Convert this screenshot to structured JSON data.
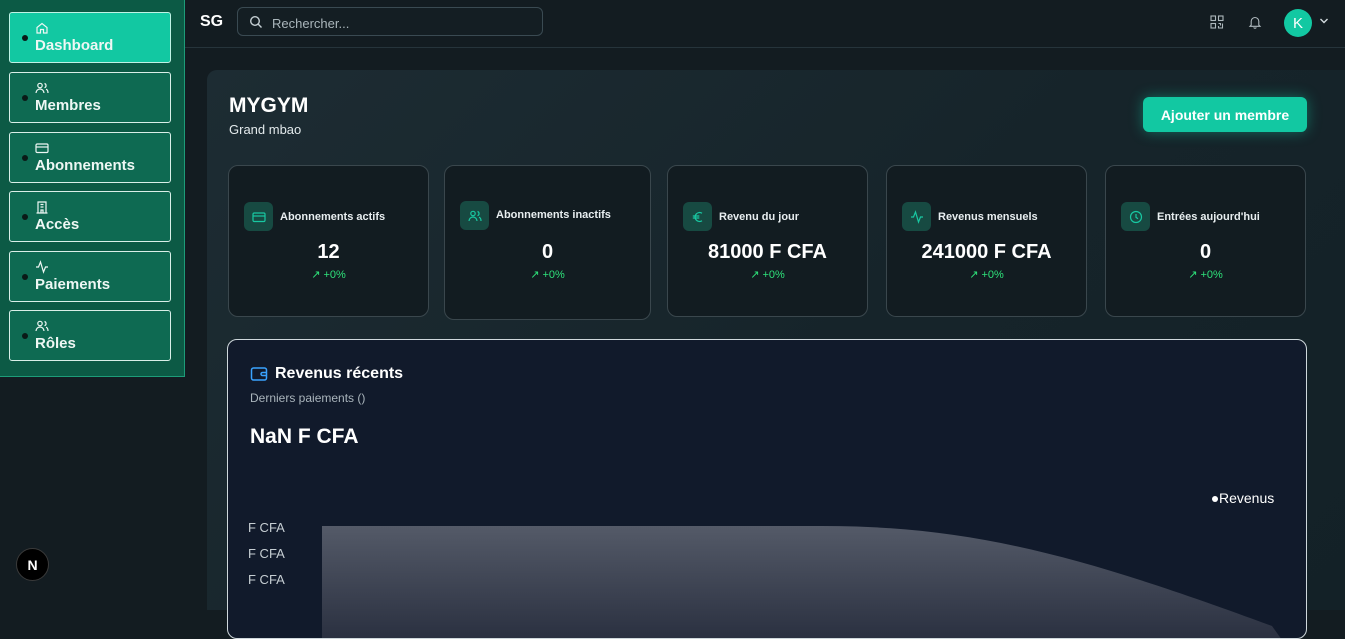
{
  "sidebar": {
    "items": [
      {
        "label": "Dashboard",
        "icon": "home-icon",
        "active": true
      },
      {
        "label": "Membres",
        "icon": "users-icon",
        "active": false
      },
      {
        "label": "Abonnements",
        "icon": "credit-card-icon",
        "active": false
      },
      {
        "label": "Accès",
        "icon": "building-icon",
        "active": false
      },
      {
        "label": "Paiements",
        "icon": "activity-icon",
        "active": false
      },
      {
        "label": "Rôles",
        "icon": "users-icon",
        "active": false
      }
    ],
    "badge": "N"
  },
  "topbar": {
    "logo": "SG",
    "search_placeholder": "Rechercher...",
    "avatar_initial": "K"
  },
  "header": {
    "title": "MYGYM",
    "subtitle": "Grand mbao",
    "add_button": "Ajouter un membre"
  },
  "stats": [
    {
      "title": "Abonnements actifs",
      "value": "12",
      "trend": "+0%",
      "icon": "credit-card-icon"
    },
    {
      "title": "Abonnements inactifs",
      "value": "0",
      "trend": "+0%",
      "icon": "users-icon"
    },
    {
      "title": "Revenu du jour",
      "value": "81000 F CFA",
      "trend": "+0%",
      "icon": "euro-icon"
    },
    {
      "title": "Revenus mensuels",
      "value": "241000 F CFA",
      "trend": "+0%",
      "icon": "activity-icon"
    },
    {
      "title": "Entrées aujourd'hui",
      "value": "0",
      "trend": "+0%",
      "icon": "clock-icon"
    }
  ],
  "revenue": {
    "title": "Revenus récents",
    "subtitle": "Derniers paiements ()",
    "total": "NaN F CFA",
    "legend": "Revenus",
    "y_ticks": [
      "F CFA",
      "F CFA",
      "F CFA"
    ]
  },
  "colors": {
    "accent": "#12c8a2",
    "sidebar_bg": "#0c5a45",
    "trend_green": "#2ee27a"
  }
}
